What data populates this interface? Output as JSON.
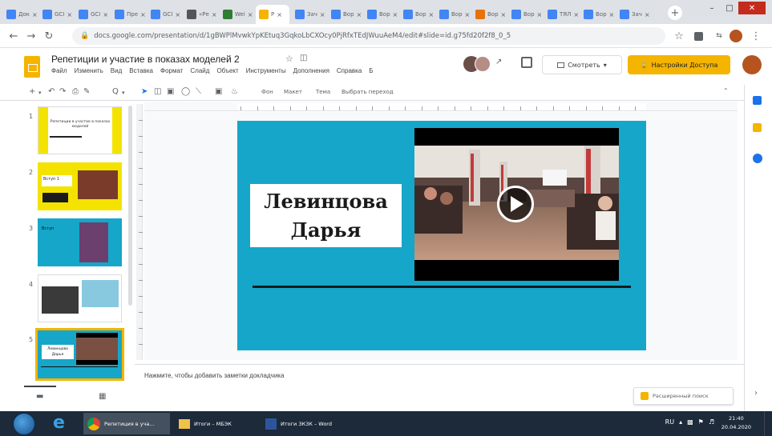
{
  "browser": {
    "tabs": [
      {
        "label": "Док",
        "color": "#4285f4"
      },
      {
        "label": "GCI",
        "color": "#4285f4"
      },
      {
        "label": "GCI",
        "color": "#4285f4"
      },
      {
        "label": "Пре",
        "color": "#4285f4"
      },
      {
        "label": "GCI",
        "color": "#4285f4"
      },
      {
        "label": "«Ре",
        "color": "#555555"
      },
      {
        "label": "Wei",
        "color": "#2e7d32"
      },
      {
        "label": "Р",
        "color": "#f4b400",
        "active": true
      },
      {
        "label": "Зач",
        "color": "#4285f4"
      },
      {
        "label": "Вор",
        "color": "#4285f4"
      },
      {
        "label": "Вор",
        "color": "#4285f4"
      },
      {
        "label": "Вор",
        "color": "#4285f4"
      },
      {
        "label": "Вор",
        "color": "#4285f4"
      },
      {
        "label": "Вор",
        "color": "#e8710a"
      },
      {
        "label": "Вор",
        "color": "#4285f4"
      },
      {
        "label": "ТЯЛ",
        "color": "#4285f4"
      },
      {
        "label": "Вор",
        "color": "#4285f4"
      },
      {
        "label": "Зач",
        "color": "#4285f4"
      }
    ],
    "new_tab": "+",
    "url": "docs.google.com/presentation/d/1gBWPlMvwkYpKEtuq3GqkoLbCXOcy0PjRfxTEdJWuuAeM4/edit#slide=id.g75fd20f2f8_0_5"
  },
  "doc": {
    "title": "Репетиции и участие в показах моделей 2",
    "menu": [
      "Файл",
      "Изменить",
      "Вид",
      "Вставка",
      "Формат",
      "Слайд",
      "Объект",
      "Инструменты",
      "Дополнения",
      "Справка",
      "Б"
    ],
    "present_label": "Смотреть",
    "share_label": "Настройки Доступа",
    "toolbar_items": [
      "Фон",
      "Макет",
      "Тема",
      "Выбрать переход"
    ],
    "zoom": "Q"
  },
  "slide": {
    "name_line1": "Левинцова",
    "name_line2": "Дарья"
  },
  "thumbnails": [
    {
      "number": "1",
      "text": "Репетиции в участие в показах моделей"
    },
    {
      "number": "2",
      "text": "Вступ 1"
    },
    {
      "number": "3",
      "text": "Вступ"
    },
    {
      "number": "4",
      "text": ""
    },
    {
      "number": "5",
      "text": "Левинцова Дарья"
    }
  ],
  "notes": {
    "placeholder": "Нажмите, чтобы добавить заметки докладчика"
  },
  "explore_label": "Расширенный поиск",
  "taskbar": {
    "items": [
      "Репетиция в уча…",
      "Итоги – МБЭК",
      "Итоги ЗКЗК – Word"
    ],
    "time": "21:40",
    "date": "20.04.2020",
    "lang": "RU"
  },
  "colors": {
    "slide_bg": "#16a6c9",
    "accent_yellow": "#f4b400",
    "share_button": "#f4b400"
  }
}
